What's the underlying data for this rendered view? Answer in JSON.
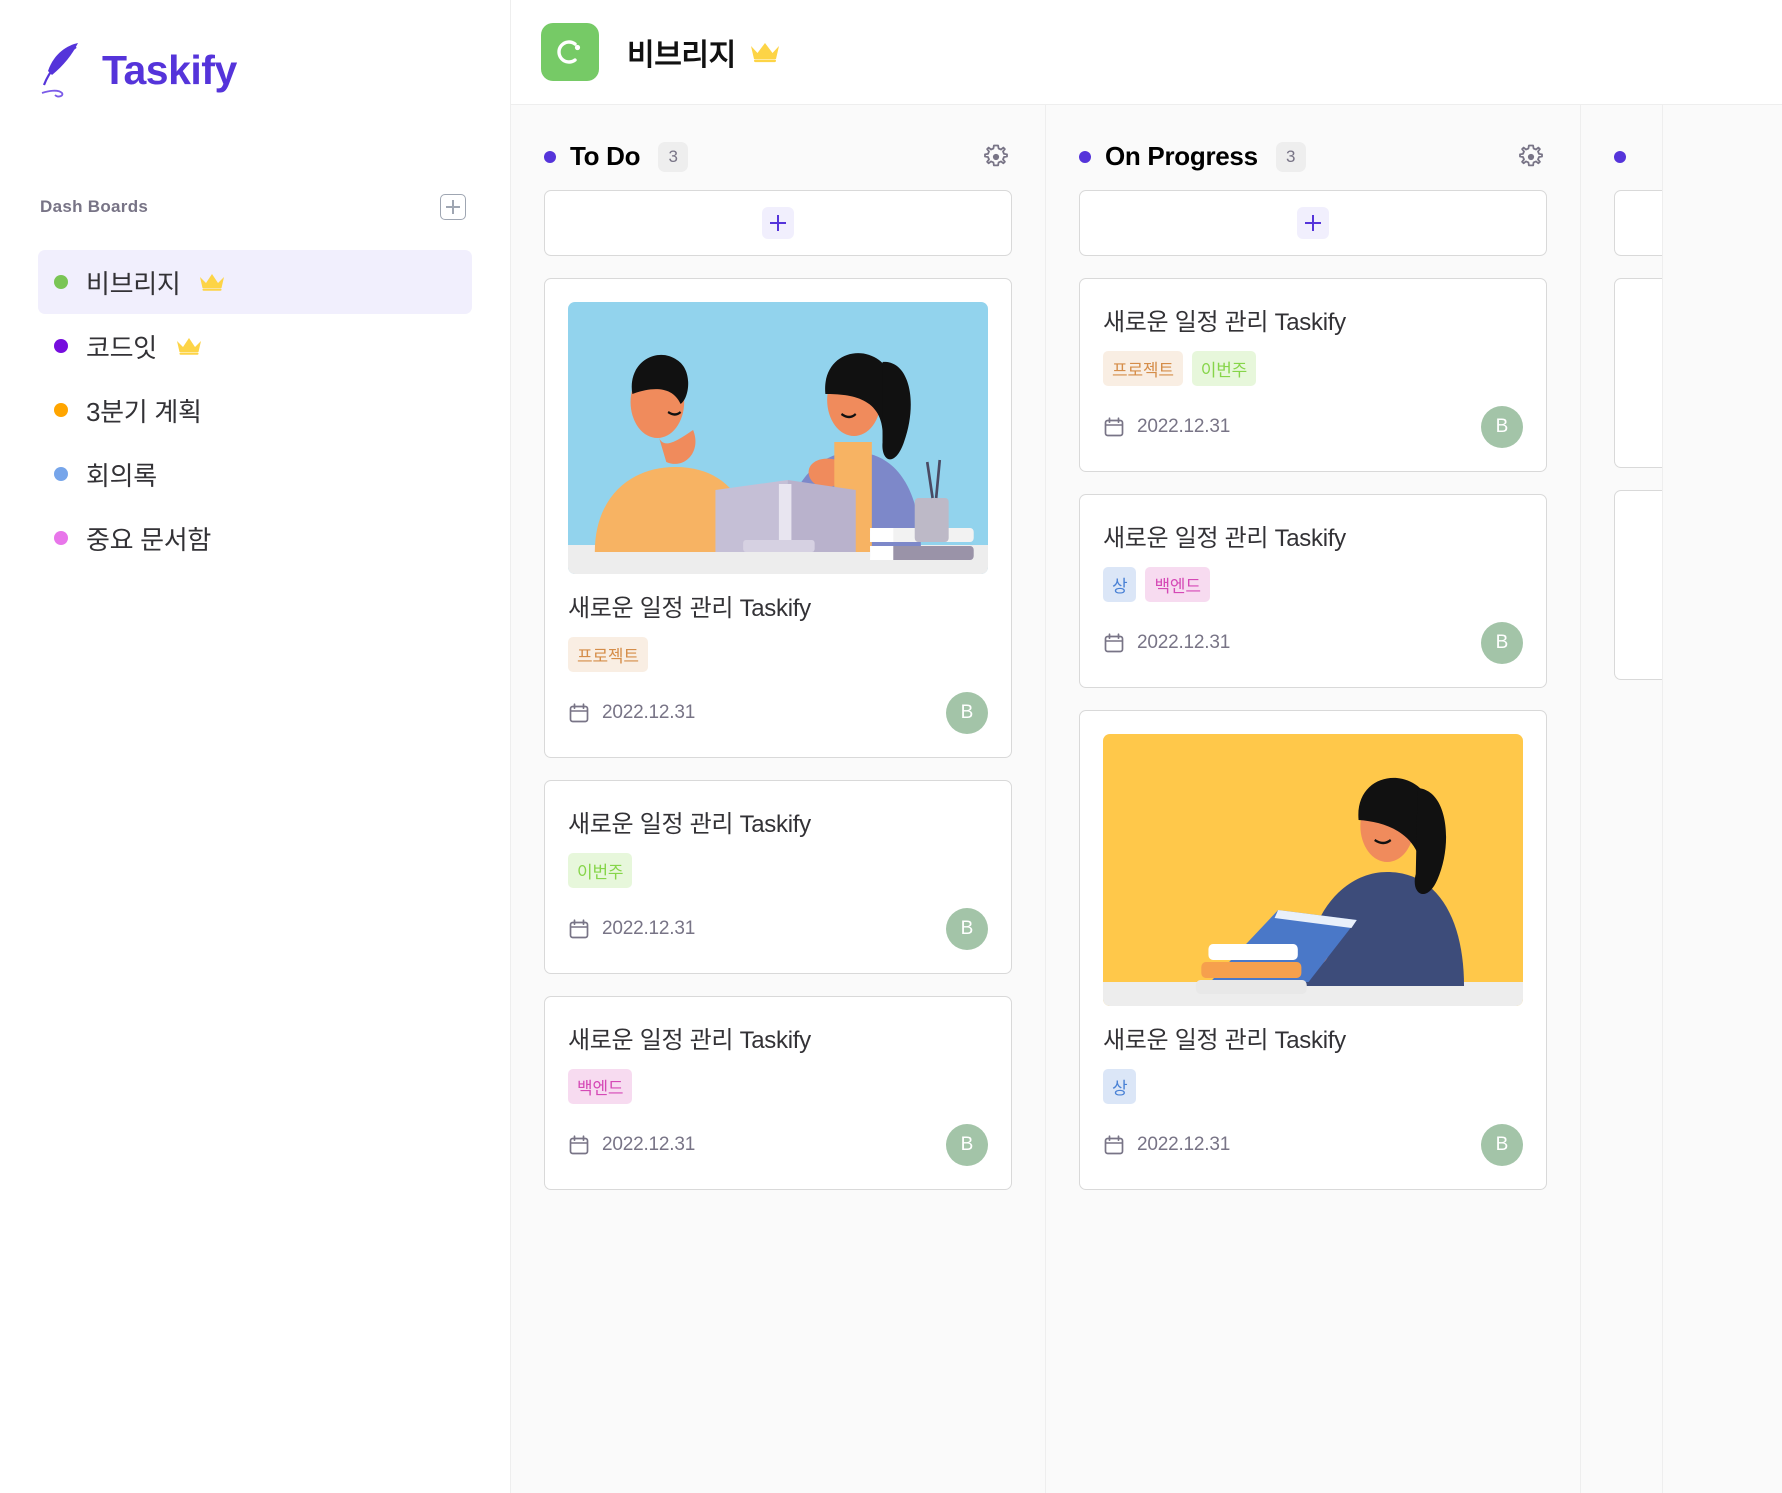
{
  "brand": {
    "name": "Taskify",
    "logo_icon": "feather-quill-icon",
    "accent_color": "#5534DA"
  },
  "sidebar": {
    "section_label": "Dash Boards",
    "add_board_icon": "plus-square-icon",
    "items": [
      {
        "label": "비브리지",
        "dot_color": "#7AC555",
        "crown": true,
        "active": true
      },
      {
        "label": "코드잇",
        "dot_color": "#760DDE",
        "crown": true,
        "active": false
      },
      {
        "label": "3분기 계획",
        "dot_color": "#FFA500",
        "crown": false,
        "active": false
      },
      {
        "label": "회의록",
        "dot_color": "#76A5EA",
        "crown": false,
        "active": false
      },
      {
        "label": "중요 문서함",
        "dot_color": "#E876EA",
        "crown": false,
        "active": false
      }
    ]
  },
  "topbar": {
    "board_icon": "comma-circle-icon",
    "board_icon_color": "#76CA66",
    "title": "비브리지",
    "crown_icon": "crown-icon"
  },
  "columns": [
    {
      "title": "To Do",
      "count": "3",
      "dot_color": "#5534DA",
      "gear_icon": "gear-icon",
      "add_icon": "plus-icon",
      "cards": [
        {
          "title": "새로운 일정 관리 Taskify",
          "thumb": "two-people-talking-illustration",
          "thumb_bg": "#92D3ED",
          "tags": [
            {
              "label": "프로젝트",
              "style": "tag-project"
            }
          ],
          "date": "2022.12.31",
          "date_icon": "calendar-icon",
          "avatar": "B",
          "avatar_color": "#A3C4A8"
        },
        {
          "title": "새로운 일정 관리 Taskify",
          "thumb": null,
          "tags": [
            {
              "label": "이번주",
              "style": "tag-week"
            }
          ],
          "date": "2022.12.31",
          "date_icon": "calendar-icon",
          "avatar": "B",
          "avatar_color": "#A3C4A8"
        },
        {
          "title": "새로운 일정 관리 Taskify",
          "thumb": null,
          "tags": [
            {
              "label": "백엔드",
              "style": "tag-backend"
            }
          ],
          "date": "2022.12.31",
          "date_icon": "calendar-icon",
          "avatar": "B",
          "avatar_color": "#A3C4A8"
        }
      ]
    },
    {
      "title": "On Progress",
      "count": "3",
      "dot_color": "#5534DA",
      "gear_icon": "gear-icon",
      "add_icon": "plus-icon",
      "cards": [
        {
          "title": "새로운 일정 관리 Taskify",
          "thumb": null,
          "tags": [
            {
              "label": "프로젝트",
              "style": "tag-project"
            },
            {
              "label": "이번주",
              "style": "tag-week"
            }
          ],
          "date": "2022.12.31",
          "date_icon": "calendar-icon",
          "avatar": "B",
          "avatar_color": "#A3C4A8"
        },
        {
          "title": "새로운 일정 관리 Taskify",
          "thumb": null,
          "tags": [
            {
              "label": "상",
              "style": "tag-high"
            },
            {
              "label": "백엔드",
              "style": "tag-backend"
            }
          ],
          "date": "2022.12.31",
          "date_icon": "calendar-icon",
          "avatar": "B",
          "avatar_color": "#A3C4A8"
        },
        {
          "title": "새로운 일정 관리 Taskify",
          "thumb": "woman-laptop-illustration",
          "thumb_bg": "#FFC84A",
          "tags": [
            {
              "label": "상",
              "style": "tag-high"
            }
          ],
          "date": "2022.12.31",
          "date_icon": "calendar-icon",
          "avatar": "B",
          "avatar_color": "#A3C4A8"
        }
      ]
    }
  ]
}
